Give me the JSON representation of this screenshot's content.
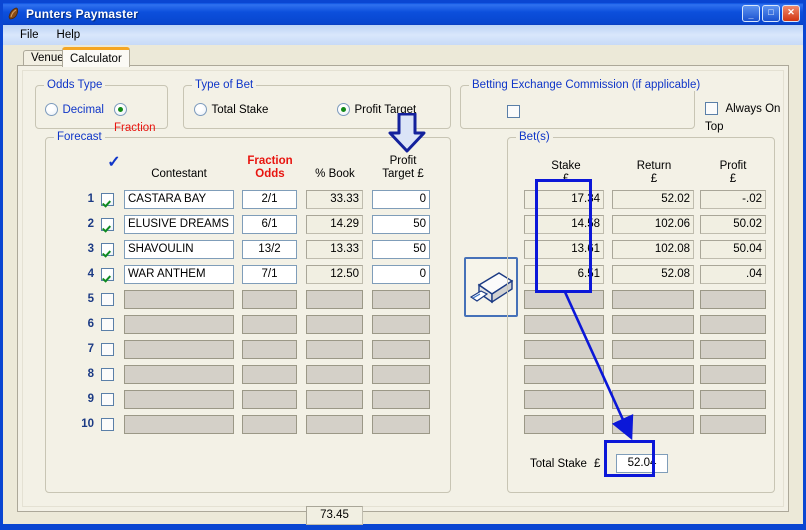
{
  "window": {
    "title": "Punters Paymaster",
    "icon": "app-icon",
    "buttons": {
      "minimize": "_",
      "maximize": "□",
      "close": "✕"
    }
  },
  "menu": {
    "items": [
      "File",
      "Help"
    ]
  },
  "tabs": [
    {
      "label": "Venue",
      "active": false
    },
    {
      "label": "Calculator",
      "active": true
    }
  ],
  "odds_type": {
    "legend": "Odds Type",
    "options": [
      {
        "label": "Decimal",
        "selected": false
      },
      {
        "label": "Fraction",
        "selected": true
      }
    ]
  },
  "type_of_bet": {
    "legend": "Type of Bet",
    "options": [
      {
        "label": "Total Stake",
        "selected": false
      },
      {
        "label": "Profit Target",
        "selected": true
      }
    ]
  },
  "commission": {
    "legend": "Betting Exchange Commission (if applicable)",
    "checked": false
  },
  "always_on_top": {
    "label": "Always On Top",
    "checked": false
  },
  "forecast": {
    "legend": "Forecast",
    "headers": {
      "check": "✓",
      "contestant": "Contestant",
      "odds_line1": "Fraction",
      "odds_line2": "Odds",
      "book": "% Book",
      "profit_line1": "Profit",
      "profit_line2": "Target £"
    },
    "rows": [
      {
        "num": "1",
        "checked": true,
        "contestant": "CASTARA BAY",
        "odds": "2/1",
        "book": "33.33",
        "profit_target": "0",
        "enabled": true
      },
      {
        "num": "2",
        "checked": true,
        "contestant": "ELUSIVE DREAMS",
        "odds": "6/1",
        "book": "14.29",
        "profit_target": "50",
        "enabled": true
      },
      {
        "num": "3",
        "checked": true,
        "contestant": "SHAVOULIN",
        "odds": "13/2",
        "book": "13.33",
        "profit_target": "50",
        "enabled": true
      },
      {
        "num": "4",
        "checked": true,
        "contestant": "WAR ANTHEM",
        "odds": "7/1",
        "book": "12.50",
        "profit_target": "0",
        "enabled": true
      },
      {
        "num": "5",
        "checked": false,
        "contestant": "",
        "odds": "",
        "book": "",
        "profit_target": "",
        "enabled": false
      },
      {
        "num": "6",
        "checked": false,
        "contestant": "",
        "odds": "",
        "book": "",
        "profit_target": "",
        "enabled": false
      },
      {
        "num": "7",
        "checked": false,
        "contestant": "",
        "odds": "",
        "book": "",
        "profit_target": "",
        "enabled": false
      },
      {
        "num": "8",
        "checked": false,
        "contestant": "",
        "odds": "",
        "book": "",
        "profit_target": "",
        "enabled": false
      },
      {
        "num": "9",
        "checked": false,
        "contestant": "",
        "odds": "",
        "book": "",
        "profit_target": "",
        "enabled": false
      },
      {
        "num": "10",
        "checked": false,
        "contestant": "",
        "odds": "",
        "book": "",
        "profit_target": "",
        "enabled": false
      }
    ],
    "book_total": "73.45"
  },
  "calculate_button": {
    "icon": "calculator-device-icon"
  },
  "bets": {
    "legend": "Bet(s)",
    "headers": {
      "stake_line1": "Stake",
      "stake_line2": "£",
      "return_line1": "Return",
      "return_line2": "£",
      "profit_line1": "Profit",
      "profit_line2": "£"
    },
    "rows": [
      {
        "stake": "17.34",
        "return": "52.02",
        "profit": "-.02",
        "enabled": true
      },
      {
        "stake": "14.58",
        "return": "102.06",
        "profit": "50.02",
        "enabled": true
      },
      {
        "stake": "13.61",
        "return": "102.08",
        "profit": "50.04",
        "enabled": true
      },
      {
        "stake": "6.51",
        "return": "52.08",
        "profit": ".04",
        "enabled": true
      },
      {
        "stake": "",
        "return": "",
        "profit": "",
        "enabled": false
      },
      {
        "stake": "",
        "return": "",
        "profit": "",
        "enabled": false
      },
      {
        "stake": "",
        "return": "",
        "profit": "",
        "enabled": false
      },
      {
        "stake": "",
        "return": "",
        "profit": "",
        "enabled": false
      },
      {
        "stake": "",
        "return": "",
        "profit": "",
        "enabled": false
      },
      {
        "stake": "",
        "return": "",
        "profit": "",
        "enabled": false
      }
    ],
    "total_stake_label": "Total Stake",
    "total_stake_currency": "£",
    "total_stake_value": "52.04"
  },
  "annotations": {
    "highlight_color": "#0b17d8",
    "arrow_color": "#0b17d8",
    "down_arrow_target": "Profit Target £ column",
    "stake_box_highlight": "Stake column rows 1-4",
    "total_stake_highlight": "Total Stake value"
  },
  "colors": {
    "window_border": "#0a46d2",
    "panel_bg": "#f3f1e6",
    "legend_blue": "#1036c8",
    "selected_red": "#e8140f",
    "tab_accent": "#f5a623"
  }
}
